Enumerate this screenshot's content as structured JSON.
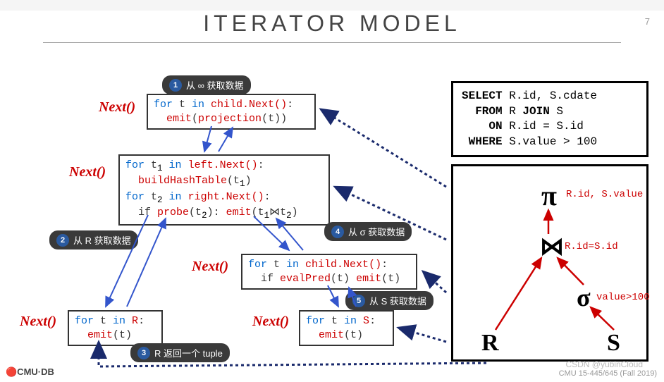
{
  "page": {
    "number": "7",
    "title": "ITERATOR MODEL"
  },
  "labels": {
    "next": "Next()"
  },
  "code": {
    "box1": {
      "l1a": "for",
      "l1b": " t ",
      "l1c": "in",
      "l1d": " child.Next()",
      "l1e": ":",
      "l2a": "emit",
      "l2b": "(",
      "l2c": "projection",
      "l2d": "(t))"
    },
    "box2": {
      "l1a": "for",
      "l1b": " t",
      "l1sub": "1",
      "l1c": " in",
      "l1d": " left.Next()",
      "l1e": ":",
      "l2a": "buildHashTable",
      "l2b": "(t",
      "l2sub": "1",
      "l2c": ")",
      "l3a": "for",
      "l3b": " t",
      "l3sub": "2",
      "l3c": " in",
      "l3d": " right.Next()",
      "l3e": ":",
      "l4a": "if ",
      "l4b": "probe",
      "l4c": "(t",
      "l4sub": "2",
      "l4d": "): ",
      "l4e": "emit",
      "l4f": "(t",
      "l4sub1": "1",
      "l4g": "⋈t",
      "l4sub2": "2",
      "l4h": ")"
    },
    "box3": {
      "l1a": "for",
      "l1b": " t ",
      "l1c": "in",
      "l1d": " child.Next()",
      "l1e": ":",
      "l2a": "if ",
      "l2b": "evalPred",
      "l2c": "(t)",
      "l2d": " emit",
      "l2e": "(t)"
    },
    "box4": {
      "l1a": "for",
      "l1b": " t ",
      "l1c": "in",
      "l1d": " R",
      "l1e": ":",
      "l2a": "emit",
      "l2b": "(t)"
    },
    "box5": {
      "l1a": "for",
      "l1b": " t ",
      "l1c": "in",
      "l1d": " S",
      "l1e": ":",
      "l2a": "emit",
      "l2b": "(t)"
    }
  },
  "bubbles": {
    "b1": {
      "num": "1",
      "text": "从 ∞ 获取数据"
    },
    "b2": {
      "num": "2",
      "text": "从 R 获取数据"
    },
    "b3": {
      "num": "3",
      "text": "R 返回一个 tuple"
    },
    "b4": {
      "num": "4",
      "text": "从 σ 获取数据"
    },
    "b5": {
      "num": "5",
      "text": "从 S 获取数据"
    }
  },
  "sql": {
    "l1a": "SELECT",
    "l1b": " R.id, S.cdate",
    "l2a": "FROM",
    "l2b": " R ",
    "l2c": "JOIN",
    "l2d": " S",
    "l3a": "ON",
    "l3b": " R.id = S.id",
    "l4a": "WHERE",
    "l4b": " S.value > 100"
  },
  "tree": {
    "pi": "π",
    "pi_label": "R.id, S.value",
    "join": "⋈",
    "join_label": "R.id=S.id",
    "sigma": "σ",
    "sigma_label": "value>100",
    "R": "R",
    "S": "S"
  },
  "footer": {
    "logo": "🔴CMU·DB",
    "right": "CMU 15-445/645 (Fall 2019)",
    "watermark": "CSDN @yubinCloud"
  }
}
